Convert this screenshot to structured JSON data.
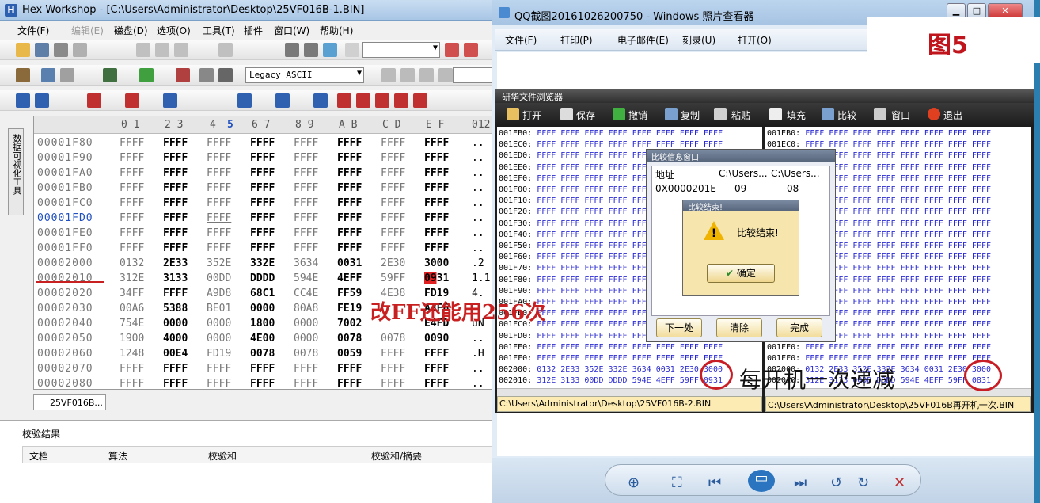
{
  "hexworkshop": {
    "title": "Hex Workshop - [C:\\Users\\Administrator\\Desktop\\25VF016B-1.BIN]",
    "menu": [
      "文件(F)",
      "编辑(E)",
      "磁盘(D)",
      "选项(O)",
      "工具(T)",
      "插件",
      "窗口(W)",
      "帮助(H)"
    ],
    "encoding": "Legacy ASCII",
    "side_tab": "数据可视化工具",
    "header_cols": [
      "0 1",
      "2 3",
      "4",
      "5",
      "6 7",
      "8 9",
      "A B",
      "C D",
      "E F",
      "012"
    ],
    "rows": [
      {
        "addr": "00001F80",
        "cells": [
          "FFFF",
          "FFFF",
          "FFFF",
          "FFFF",
          "FFFF",
          "FFFF",
          "FFFF",
          "FFFF"
        ],
        "ascii": ".."
      },
      {
        "addr": "00001F90",
        "cells": [
          "FFFF",
          "FFFF",
          "FFFF",
          "FFFF",
          "FFFF",
          "FFFF",
          "FFFF",
          "FFFF"
        ],
        "ascii": ".."
      },
      {
        "addr": "00001FA0",
        "cells": [
          "FFFF",
          "FFFF",
          "FFFF",
          "FFFF",
          "FFFF",
          "FFFF",
          "FFFF",
          "FFFF"
        ],
        "ascii": ".."
      },
      {
        "addr": "00001FB0",
        "cells": [
          "FFFF",
          "FFFF",
          "FFFF",
          "FFFF",
          "FFFF",
          "FFFF",
          "FFFF",
          "FFFF"
        ],
        "ascii": ".."
      },
      {
        "addr": "00001FC0",
        "cells": [
          "FFFF",
          "FFFF",
          "FFFF",
          "FFFF",
          "FFFF",
          "FFFF",
          "FFFF",
          "FFFF"
        ],
        "ascii": ".."
      },
      {
        "addr": "00001FD0",
        "cells": [
          "FFFF",
          "FFFF",
          "FFFF",
          "FFFF",
          "FFFF",
          "FFFF",
          "FFFF",
          "FFFF"
        ],
        "ascii": ".."
      },
      {
        "addr": "00001FE0",
        "cells": [
          "FFFF",
          "FFFF",
          "FFFF",
          "FFFF",
          "FFFF",
          "FFFF",
          "FFFF",
          "FFFF"
        ],
        "ascii": ".."
      },
      {
        "addr": "00001FF0",
        "cells": [
          "FFFF",
          "FFFF",
          "FFFF",
          "FFFF",
          "FFFF",
          "FFFF",
          "FFFF",
          "FFFF"
        ],
        "ascii": ".."
      },
      {
        "addr": "00002000",
        "cells": [
          "0132",
          "2E33",
          "352E",
          "332E",
          "3634",
          "0031",
          "2E30",
          "3000"
        ],
        "ascii": ".2"
      },
      {
        "addr": "00002010",
        "cells": [
          "312E",
          "3133",
          "00DD",
          "DDDD",
          "594E",
          "4EFF",
          "59FF",
          "0931"
        ],
        "ascii": "1.1"
      },
      {
        "addr": "00002020",
        "cells": [
          "34FF",
          "FFFF",
          "A9D8",
          "68C1",
          "CC4E",
          "FF59",
          "4E38",
          "FD19"
        ],
        "ascii": "4."
      },
      {
        "addr": "00002030",
        "cells": [
          "00A6",
          "5388",
          "BE01",
          "0000",
          "80A8",
          "FE19",
          "",
          "A3F6"
        ],
        "ascii": ""
      },
      {
        "addr": "00002040",
        "cells": [
          "754E",
          "0000",
          "0000",
          "1800",
          "0000",
          "7002",
          "",
          "E4FD"
        ],
        "ascii": "uN"
      },
      {
        "addr": "00002050",
        "cells": [
          "1900",
          "4000",
          "0000",
          "4E00",
          "0000",
          "0078",
          "0078",
          "0090"
        ],
        "ascii": ".."
      },
      {
        "addr": "00002060",
        "cells": [
          "1248",
          "00E4",
          "FD19",
          "0078",
          "0078",
          "0059",
          "FFFF",
          "FFFF"
        ],
        "ascii": ".H"
      },
      {
        "addr": "00002070",
        "cells": [
          "FFFF",
          "FFFF",
          "FFFF",
          "FFFF",
          "FFFF",
          "FFFF",
          "FFFF",
          "FFFF"
        ],
        "ascii": ".."
      },
      {
        "addr": "00002080",
        "cells": [
          "FFFF",
          "FFFF",
          "FFFF",
          "FFFF",
          "FFFF",
          "FFFF",
          "FFFF",
          "FFFF"
        ],
        "ascii": ".."
      }
    ],
    "file_tab": "25VF016B...",
    "verify_title": "校验结果",
    "verify_cols": [
      "文档",
      "算法",
      "校验和",
      "校验和/摘要"
    ]
  },
  "annotations": {
    "red_text": "改FF还能用256次",
    "black_text": "每开机一次递减",
    "figure_label": "图5"
  },
  "viewer": {
    "title": "QQ截图20161026200750 - Windows 照片查看器",
    "menu": [
      "文件(F)",
      "打印(P)",
      "电子邮件(E)",
      "刻录(U)",
      "打开(O)"
    ]
  },
  "compare_browser": {
    "title": "研华文件浏览器",
    "tools": [
      "打开",
      "保存",
      "撤销",
      "复制",
      "粘贴",
      "填充",
      "比较",
      "窗口",
      "退出"
    ],
    "left_lines": [
      [
        "001EB0:",
        "FFFF FFFF FFFF FFFF FFFF FFFF FFFF FFFF"
      ],
      [
        "001EC0:",
        "FFFF FFFF FFFF FFFF FFFF FFFF FFFF FFFF"
      ],
      [
        "001ED0:",
        "FFFF FFFF FFFF FFFF FFFF FFFF FFFF FFFF"
      ],
      [
        "001EE0:",
        "FFFF FFFF FFFF FFFF FFFF FFFF FFFF FFFF"
      ],
      [
        "001EF0:",
        "FFFF FFFF FFFF FFFF FFFF FFFF FFFF FFFF"
      ],
      [
        "001F00:",
        "FFFF FFFF FFFF FFFF FFFF FFFF FFFF FFFF"
      ],
      [
        "001F10:",
        "FFFF FFFF FFFF FFFF FFFF FFFF FFFF FFFF"
      ],
      [
        "001F20:",
        "FFFF FFFF FFFF FFFF FFFF FFFF FFFF FFFF"
      ],
      [
        "001F30:",
        "FFFF FFFF FFFF FFFF FFFF FFFF FFFF FFFF"
      ],
      [
        "001F40:",
        "FFFF FFFF FFFF FFFF FFFF FFFF FFFF FFFF"
      ],
      [
        "001F50:",
        "FFFF FFFF FFFF FFFF FFFF FFFF FFFF FFFF"
      ],
      [
        "001F60:",
        "FFFF FFFF FFFF FFFF FFFF FFFF FFFF FFFF"
      ],
      [
        "001F70:",
        "FFFF FFFF FFFF FFFF FFFF FFFF FFFF FFFF"
      ],
      [
        "001F80:",
        "FFFF FFFF FFFF FFFF FFFF FFFF FFFF FFFF"
      ],
      [
        "001F90:",
        "FFFF FFFF FFFF FFFF FFFF FFFF FFFF FFFF"
      ],
      [
        "001FA0:",
        "FFFF FFFF FFFF FFFF FFFF FFFF FFFF FFFF"
      ],
      [
        "001FB0:",
        "FFFF FFFF FFFF FFFF FFFF FFFF FFFF FFFF"
      ],
      [
        "001FC0:",
        "FFFF FFFF FFFF FFFF FFFF FFFF FFFF FFFF"
      ],
      [
        "001FD0:",
        "FFFF FFFF FFFF FFFF FFFF FFFF FFFF FFFF"
      ],
      [
        "001FE0:",
        "FFFF FFFF FFFF FFFF FFFF FFFF FFFF FFFF"
      ],
      [
        "001FF0:",
        "FFFF FFFF FFFF FFFF FFFF FFFF FFFF FFFF"
      ],
      [
        "002000:",
        "0132 2E33 352E 332E 3634 0031 2E30 3000"
      ],
      [
        "002010:",
        "312E 3133 00DD DDDD 594E 4EFF 59FF 0931"
      ]
    ],
    "right_lines": [
      [
        "001EB0:",
        "FFFF FFFF FFFF FFFF FFFF FFFF FFFF FFFF"
      ],
      [
        "001EC0:",
        "FFFF FFFF FFFF FFFF FFFF FFFF FFFF FFFF"
      ],
      [
        "001ED0:",
        "FFFF FFFF FFFF FFFF FFFF FFFF FFFF FFFF"
      ],
      [
        "001EE0:",
        "FFFF FFFF FFFF FFFF FFFF FFFF FFFF FFFF"
      ],
      [
        "001EF0:",
        "FFFF FFFF FFFF FFFF FFFF FFFF FFFF FFFF"
      ],
      [
        "001F00:",
        "FFFF FFFF FFFF FFFF FFFF FFFF FFFF FFFF"
      ],
      [
        "001F10:",
        "FFFF FFFF FFFF FFFF FFFF FFFF FFFF FFFF"
      ],
      [
        "001F20:",
        "FFFF FFFF FFFF FFFF FFFF FFFF FFFF FFFF"
      ],
      [
        "001F30:",
        "FFFF FFFF FFFF FFFF FFFF FFFF FFFF FFFF"
      ],
      [
        "001F40:",
        "FFFF FFFF FFFF FFFF FFFF FFFF FFFF FFFF"
      ],
      [
        "001F50:",
        "FFFF FFFF FFFF FFFF FFFF FFFF FFFF FFFF"
      ],
      [
        "001F60:",
        "FFFF FFFF FFFF FFFF FFFF FFFF FFFF FFFF"
      ],
      [
        "001F70:",
        "FFFF FFFF FFFF FFFF FFFF FFFF FFFF FFFF"
      ],
      [
        "001F80:",
        "FFFF FFFF FFFF FFFF FFFF FFFF FFFF FFFF"
      ],
      [
        "001F90:",
        "FFFF FFFF FFFF FFFF FFFF FFFF FFFF FFFF"
      ],
      [
        "001FA0:",
        "FFFF FFFF FFFF FFFF FFFF FFFF FFFF FFFF"
      ],
      [
        "001FB0:",
        "FFFF FFFF FFFF FFFF FFFF FFFF FFFF FFFF"
      ],
      [
        "001FC0:",
        "FFFF FFFF FFFF FFFF FFFF FFFF FFFF FFFF"
      ],
      [
        "001FD0:",
        "FFFF FFFF FFFF FFFF FFFF FFFF FFFF FFFF"
      ],
      [
        "001FE0:",
        "FFFF FFFF FFFF FFFF FFFF FFFF FFFF FFFF"
      ],
      [
        "001FF0:",
        "FFFF FFFF FFFF FFFF FFFF FFFF FFFF FFFF"
      ],
      [
        "002000:",
        "0132 2E33 352E 332E 3634 0031 2E30 3000"
      ],
      [
        "002010:",
        "312E 3133 00DD DDDD 594E 4EFF 59FF 0831"
      ]
    ],
    "left_status": "C:\\Users\\Administrator\\Desktop\\25VF016B-2.BIN",
    "right_status": "C:\\Users\\Administrator\\Desktop\\25VF016B再开机一次.BIN"
  },
  "compare_dialog": {
    "title": "比较信息窗口",
    "cols": [
      "地址",
      "C:\\Users...",
      "C:\\Users..."
    ],
    "row": [
      "0X0000201E",
      "09",
      "08"
    ],
    "buttons": [
      "下一处",
      "清除",
      "完成"
    ]
  },
  "message_box": {
    "title": "比较结束!",
    "text": "比较结束!",
    "ok": "确定"
  },
  "colors": {
    "accent_red": "#c81d25",
    "diff_highlight": "#e02020"
  }
}
